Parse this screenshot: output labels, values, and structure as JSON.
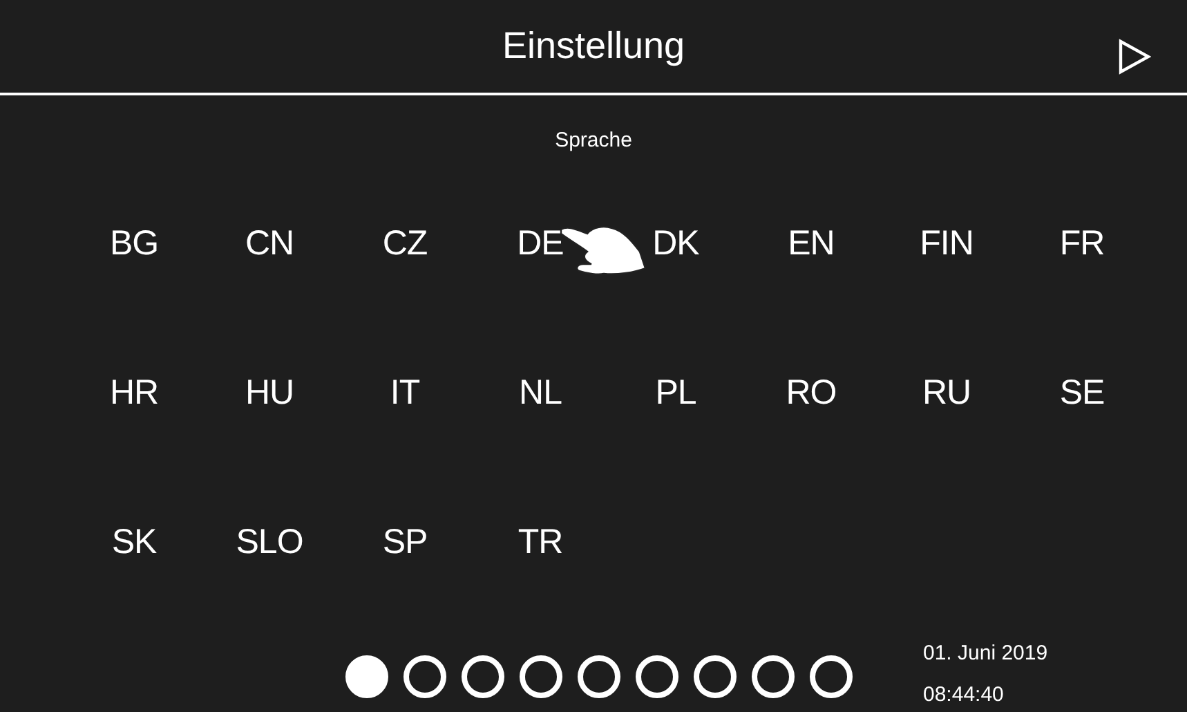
{
  "header": {
    "title": "Einstellung"
  },
  "section": {
    "title": "Sprache"
  },
  "languages": [
    "BG",
    "CN",
    "CZ",
    "DE",
    "DK",
    "EN",
    "FIN",
    "FR",
    "HR",
    "HU",
    "IT",
    "NL",
    "PL",
    "RO",
    "RU",
    "SE",
    "SK",
    "SLO",
    "SP",
    "TR"
  ],
  "pages": [
    {
      "selected": true
    },
    {
      "selected": false
    },
    {
      "selected": false
    },
    {
      "selected": false
    },
    {
      "selected": false
    },
    {
      "selected": false
    },
    {
      "selected": false
    },
    {
      "selected": false
    },
    {
      "selected": false
    }
  ],
  "status": {
    "date": "01. Juni 2019",
    "time": "08:44:40"
  }
}
